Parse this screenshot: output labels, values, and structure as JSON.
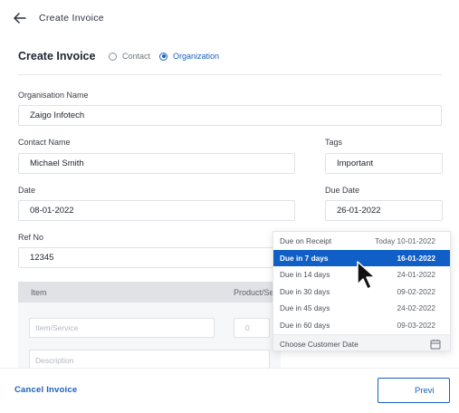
{
  "header": {
    "title": "Create Invoice",
    "back_icon": "arrow-left-icon"
  },
  "form": {
    "title": "Create Invoice",
    "recipient_type": {
      "options": [
        "Contact",
        "Organization"
      ],
      "selected": "Organization"
    },
    "organisation_name": {
      "label": "Organisation Name",
      "value": "Zaigo Infotech"
    },
    "contact_name": {
      "label": "Contact Name",
      "value": "Michael Smith"
    },
    "tags": {
      "label": "Tags",
      "value": "Important"
    },
    "date": {
      "label": "Date",
      "value": "08-01-2022"
    },
    "due_date": {
      "label": "Due Date",
      "value": "26-01-2022"
    },
    "ref_no": {
      "label": "Ref No",
      "value": "12345"
    }
  },
  "items": {
    "columns": [
      "Item",
      "Product/Se"
    ],
    "item_placeholder": "Item/Service",
    "qty_value": "0",
    "description_placeholder": "Description"
  },
  "due_dropdown": {
    "peek_label": "Due on Receipt",
    "options": [
      {
        "label": "Due on Receipt",
        "date": "Today 10-01-2022",
        "selected": false
      },
      {
        "label": "Due in 7 days",
        "date": "16-01-2022",
        "selected": true
      },
      {
        "label": "Due in 14 days",
        "date": "24-01-2022",
        "selected": false
      },
      {
        "label": "Due in 30 days",
        "date": "09-02-2022",
        "selected": false
      },
      {
        "label": "Due in 45 days",
        "date": "24-02-2022",
        "selected": false
      },
      {
        "label": "Due in 60 days",
        "date": "09-03-2022",
        "selected": false
      }
    ],
    "footer_label": "Choose Customer Date",
    "footer_icon": "calendar-icon"
  },
  "footer": {
    "cancel_label": "Cancel Invoice",
    "preview_label": "Previ"
  },
  "colors": {
    "accent": "#1a5fbf",
    "selected_row": "#0f5fc6",
    "table_header": "#e0e2e6"
  }
}
